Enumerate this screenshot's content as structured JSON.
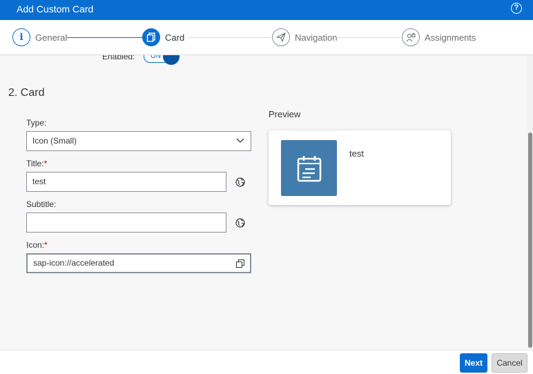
{
  "window": {
    "title": "Add Custom Card",
    "help_glyph": "?"
  },
  "wizard": {
    "steps": [
      {
        "label": "General",
        "status": "done",
        "glyph": "i"
      },
      {
        "label": "Card",
        "status": "active"
      },
      {
        "label": "Navigation",
        "status": "todo"
      },
      {
        "label": "Assignments",
        "status": "todo"
      }
    ]
  },
  "enabled": {
    "label": "Enabled:",
    "state": "ON"
  },
  "section": {
    "title": "2. Card"
  },
  "form": {
    "type": {
      "label": "Type:",
      "value": "Icon (Small)"
    },
    "title": {
      "label": "Title:",
      "required": "*",
      "value": "test"
    },
    "subtitle": {
      "label": "Subtitle:",
      "value": ""
    },
    "icon": {
      "label": "Icon:",
      "required": "*",
      "value": "sap-icon://accelerated"
    }
  },
  "preview": {
    "heading": "Preview",
    "card_title": "test",
    "icon_name": "accelerated-icon",
    "tile_color": "#427cac"
  },
  "footer": {
    "next_label": "Next",
    "cancel_label": "Cancel"
  },
  "colors": {
    "brand": "#0a6ed1",
    "required": "#bb0000"
  }
}
